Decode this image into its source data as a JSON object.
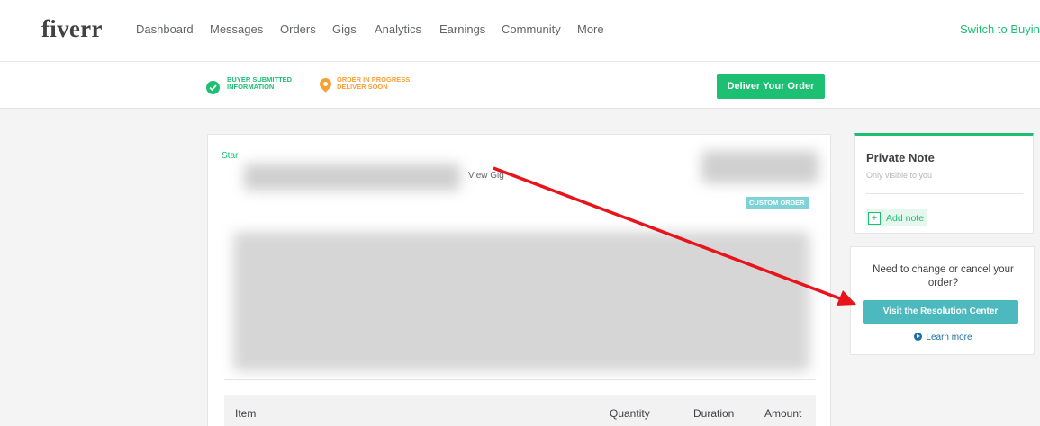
{
  "nav": {
    "logo": "fiverr",
    "items": [
      "Dashboard",
      "Messages",
      "Orders",
      "Gigs",
      "Analytics",
      "Earnings",
      "Community",
      "More"
    ],
    "switch_label": "Switch to Buying"
  },
  "status": {
    "step1_line1": "BUYER SUBMITTED",
    "step1_line2": "INFORMATION",
    "step2_line1": "ORDER IN PROGRESS",
    "step2_line2": "DELIVER SOON",
    "deliver_button": "Deliver Your Order"
  },
  "order": {
    "star_label": "Star",
    "view_gig": "View Gig",
    "custom_badge": "CUSTOM ORDER",
    "table_headers": {
      "item": "Item",
      "quantity": "Quantity",
      "duration": "Duration",
      "amount": "Amount"
    }
  },
  "private_note": {
    "title": "Private Note",
    "subtitle": "Only visible to you",
    "add_note": "Add note"
  },
  "resolution": {
    "text": "Need to change or cancel your order?",
    "button": "Visit the Resolution Center",
    "learn_more": "Learn more"
  },
  "colors": {
    "brand_green": "#1dbf73",
    "progress_orange": "#f7a034",
    "resolution_teal": "#4bb9bd",
    "annotation_red": "#e8141b"
  }
}
